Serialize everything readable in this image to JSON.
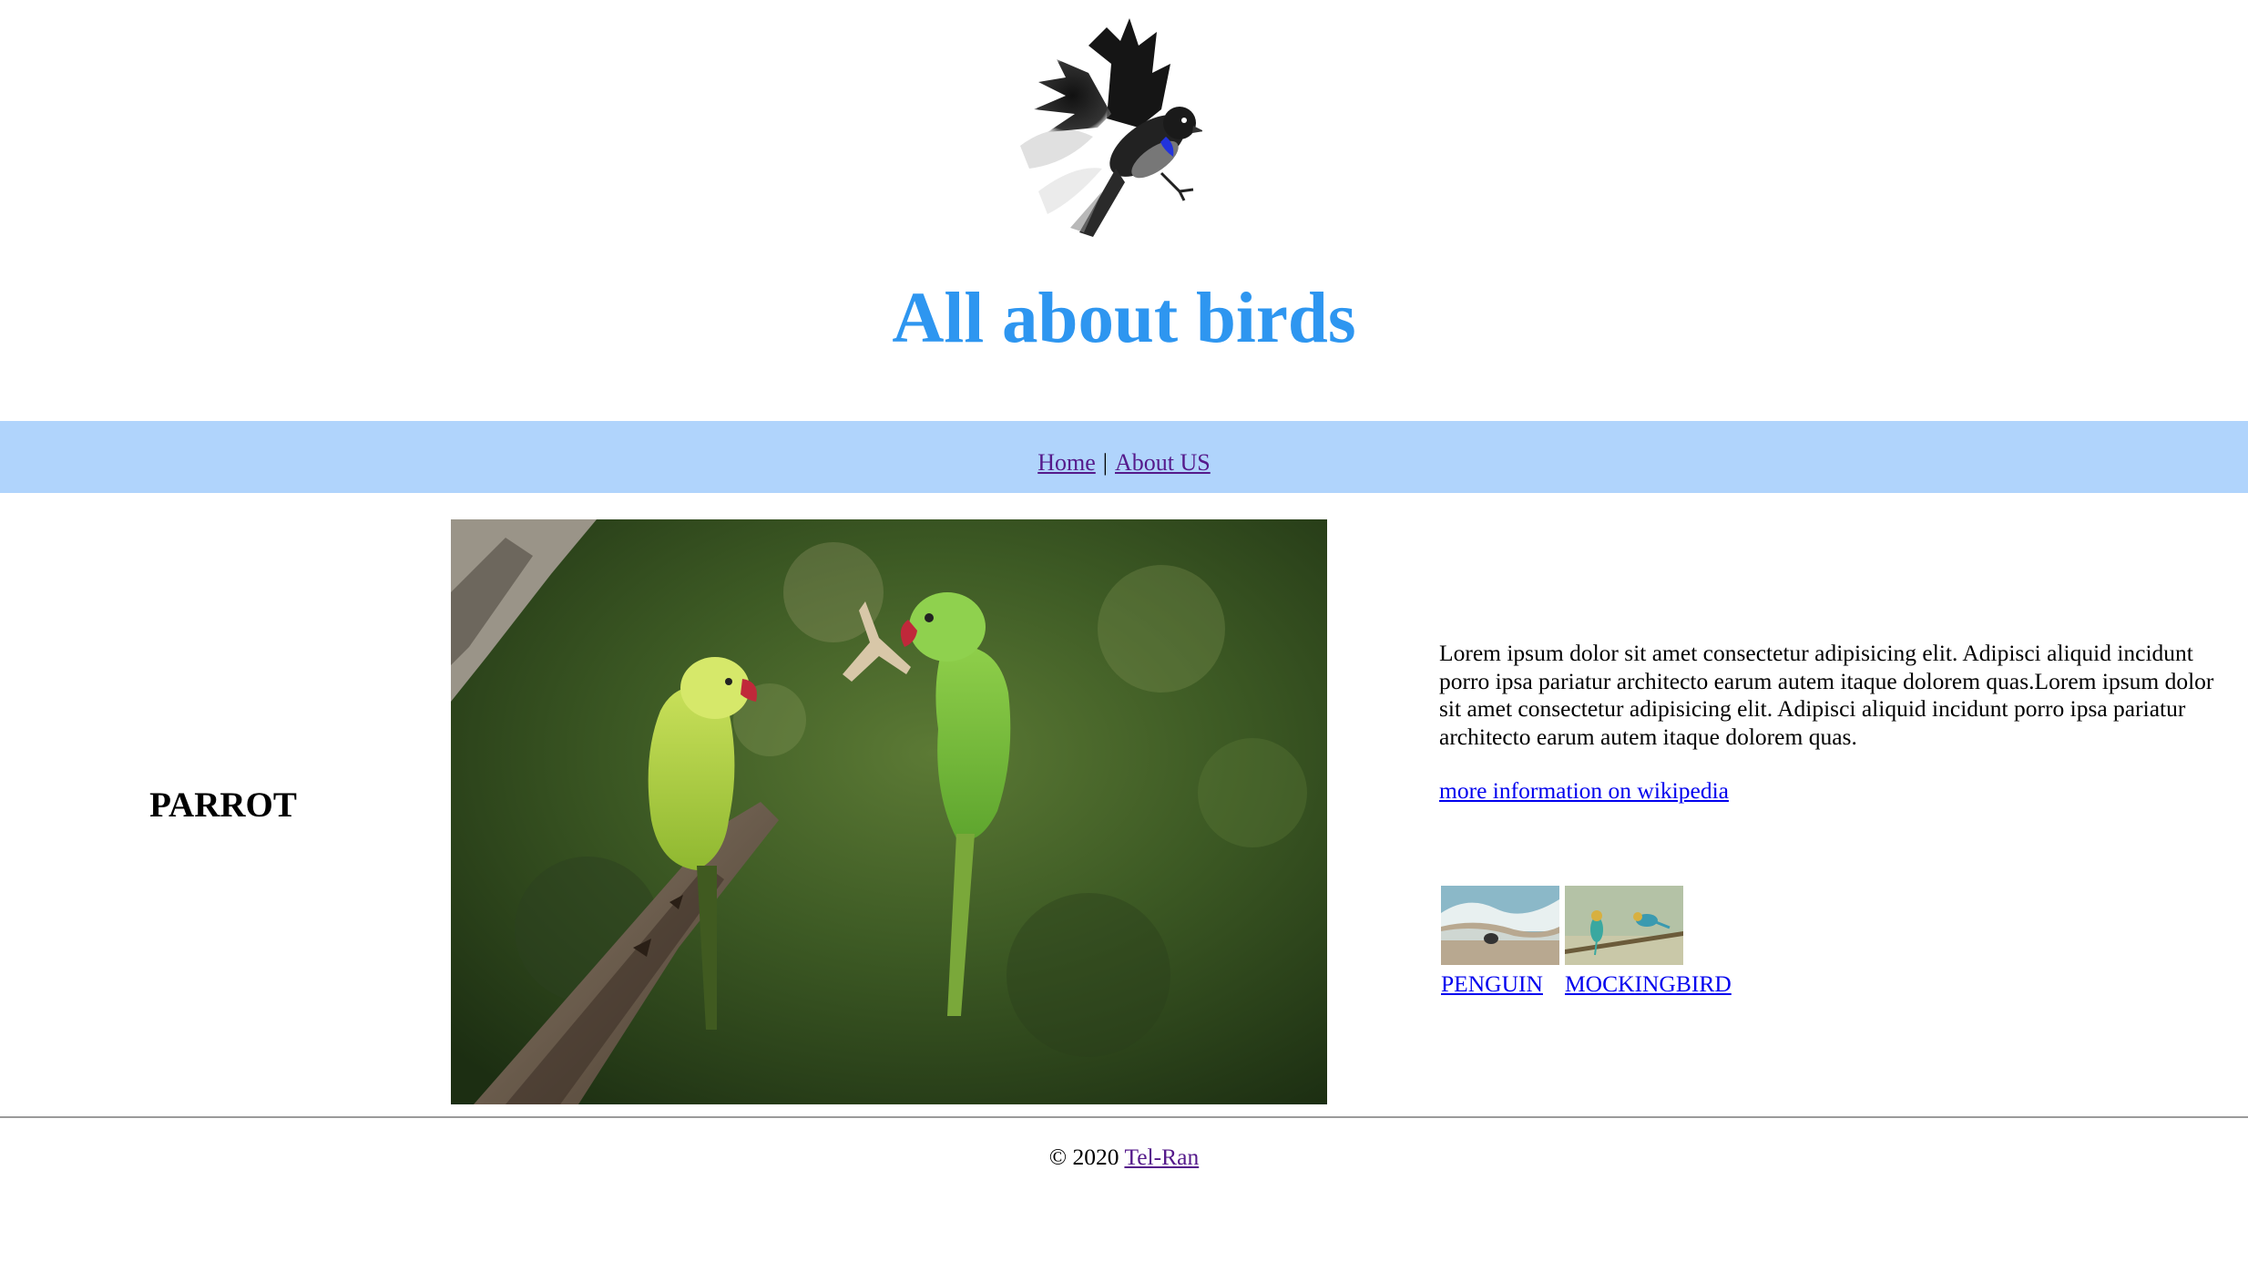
{
  "header": {
    "logo_icon": "flying-bird-logo",
    "title": "All about birds"
  },
  "nav": {
    "home_label": "Home",
    "separator": "|",
    "about_label": "About US"
  },
  "article": {
    "bird_name": "PARROT",
    "photo_icon": "parrot-photo",
    "description": "Lorem ipsum dolor sit amet consectetur adipisicing elit. Adipisci aliquid incidunt porro ipsa pariatur architecto earum autem itaque dolorem quas.Lorem ipsum dolor sit amet consectetur adipisicing elit. Adipisci aliquid incidunt porro ipsa pariatur architecto earum autem itaque dolorem quas.",
    "wiki_link": "more information on wikipedia"
  },
  "related": [
    {
      "label": "PENGUIN",
      "icon": "penguin-thumbnail"
    },
    {
      "label": "MOCKINGBIRD",
      "icon": "mockingbird-thumbnail"
    }
  ],
  "footer": {
    "copyright": "© 2020",
    "link": "Tel-Ran"
  },
  "colors": {
    "title": "#2e96f0",
    "nav_background": "#b0d4fc",
    "visited_link": "#551a8b",
    "link": "#0000ee",
    "rule": "#9a9a9a"
  }
}
